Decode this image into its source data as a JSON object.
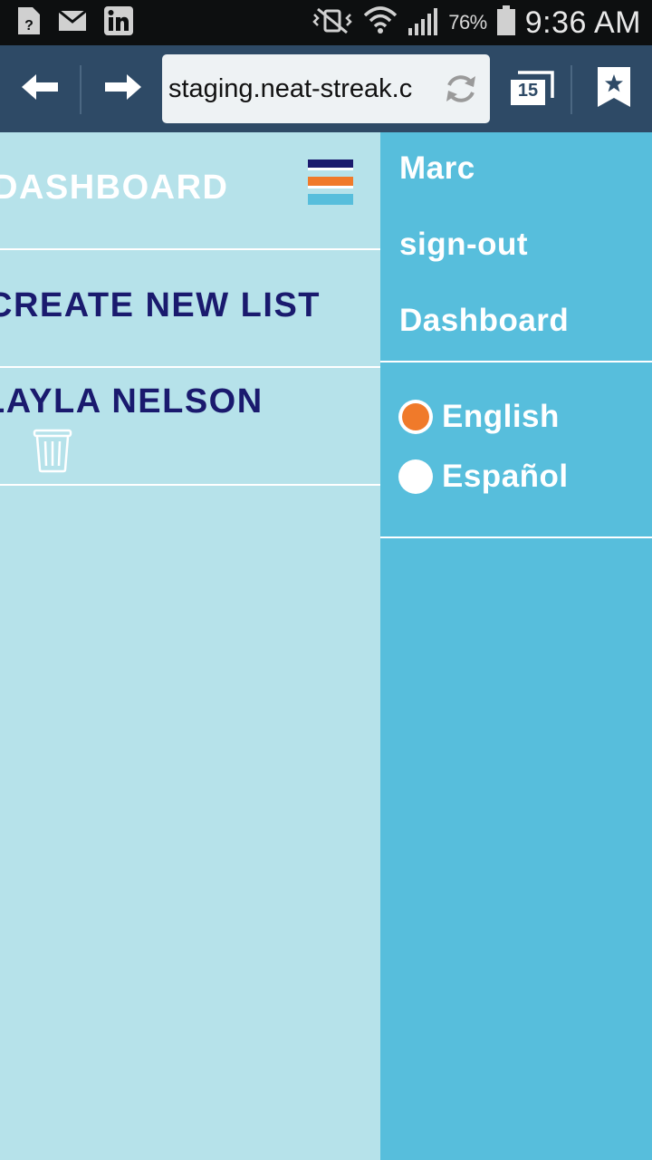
{
  "status_bar": {
    "battery_percent": "76%",
    "time": "9:36 AM",
    "left_icons": [
      "unknown-notification-icon",
      "mail-icon",
      "linkedin-icon"
    ],
    "right_icons": [
      "vibrate-mute-icon",
      "wifi-icon",
      "signal-icon",
      "battery-icon"
    ]
  },
  "browser": {
    "url": "staging.neat-streak.c",
    "tab_count": "15",
    "icons": [
      "back-arrow-icon",
      "forward-arrow-icon",
      "reload-icon",
      "tabs-icon",
      "bookmark-icon"
    ]
  },
  "page": {
    "header_title": "DASHBOARD",
    "create_list_label": "CREATE NEW LIST",
    "list_item_name": "LAYLA NELSON",
    "icons": [
      "hamburger-menu-icon",
      "trash-icon"
    ]
  },
  "side_menu": {
    "items": [
      {
        "label": "Marc"
      },
      {
        "label": "sign-out"
      },
      {
        "label": "Dashboard"
      }
    ],
    "languages": [
      {
        "label": "English",
        "selected": true
      },
      {
        "label": "Español",
        "selected": false
      }
    ]
  },
  "colors": {
    "status_bar_bg": "#0d0f10",
    "toolbar_bg": "#2e4a66",
    "page_bg": "#b6e2ea",
    "menu_bg": "#57bedc",
    "heading_dark": "#1a1a6e",
    "accent_orange": "#f07a2a"
  }
}
